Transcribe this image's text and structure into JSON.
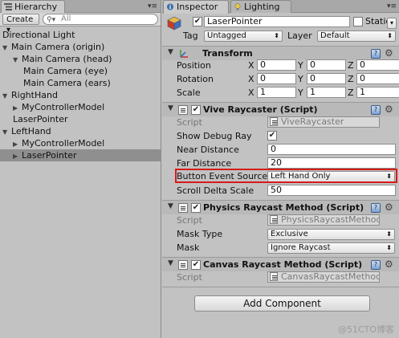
{
  "hierarchy": {
    "tab_label": "Hierarchy",
    "create_label": "Create",
    "search_placeholder": "All",
    "items": [
      {
        "label": "Directional Light",
        "level": 0,
        "arrow": ""
      },
      {
        "label": "Main Camera (origin)",
        "level": 0,
        "arrow": "▼"
      },
      {
        "label": "Main Camera (head)",
        "level": 1,
        "arrow": "▼"
      },
      {
        "label": "Main Camera (eye)",
        "level": 2,
        "arrow": ""
      },
      {
        "label": "Main Camera (ears)",
        "level": 2,
        "arrow": ""
      },
      {
        "label": "RightHand",
        "level": 0,
        "arrow": "▼"
      },
      {
        "label": "MyControllerModel",
        "level": 1,
        "arrow": "▶"
      },
      {
        "label": "LaserPointer",
        "level": 1,
        "arrow": ""
      },
      {
        "label": "LeftHand",
        "level": 0,
        "arrow": "▼"
      },
      {
        "label": "MyControllerModel",
        "level": 1,
        "arrow": "▶"
      },
      {
        "label": "LaserPointer",
        "level": 1,
        "arrow": "▶",
        "selected": true
      }
    ]
  },
  "inspector": {
    "tab_label": "Inspector",
    "lighting_tab_label": "Lighting",
    "object_name": "LaserPointer",
    "static_label": "Static",
    "tag_label": "Tag",
    "tag_value": "Untagged",
    "layer_label": "Layer",
    "layer_value": "Default",
    "transform": {
      "title": "Transform",
      "rows": [
        {
          "label": "Position",
          "x": "0",
          "y": "0",
          "z": "0"
        },
        {
          "label": "Rotation",
          "x": "0",
          "y": "0",
          "z": "0"
        },
        {
          "label": "Scale",
          "x": "1",
          "y": "1",
          "z": "1"
        }
      ],
      "axis_x": "X",
      "axis_y": "Y",
      "axis_z": "Z"
    },
    "vive_raycaster": {
      "title": "Vive Raycaster (Script)",
      "script_label": "Script",
      "script_value": "ViveRaycaster",
      "show_debug_ray_label": "Show Debug Ray",
      "show_debug_ray_checked": true,
      "near_distance_label": "Near Distance",
      "near_distance_value": "0",
      "far_distance_label": "Far Distance",
      "far_distance_value": "20",
      "button_event_source_label": "Button Event Source",
      "button_event_source_value": "Left Hand Only",
      "scroll_delta_scale_label": "Scroll Delta Scale",
      "scroll_delta_scale_value": "50"
    },
    "physics_raycast": {
      "title": "Physics Raycast Method (Script)",
      "script_label": "Script",
      "script_value": "PhysicsRaycastMethod",
      "mask_type_label": "Mask Type",
      "mask_type_value": "Exclusive",
      "mask_label": "Mask",
      "mask_value": "Ignore Raycast"
    },
    "canvas_raycast": {
      "title": "Canvas Raycast Method (Script)",
      "script_label": "Script",
      "script_value": "CanvasRaycastMethod"
    },
    "add_component_label": "Add Component"
  },
  "watermark": "@51CTO博客",
  "colors": {
    "panel_bg": "#c2c2c2",
    "selection": "#8f8f8f",
    "highlight_border": "#d71a1a"
  }
}
